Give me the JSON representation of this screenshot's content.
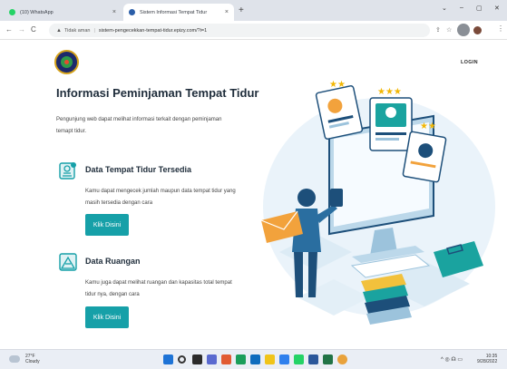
{
  "browser": {
    "tabs": [
      {
        "title": "(10) WhatsApp",
        "favicon_color": "#25d366"
      },
      {
        "title": "Sistem Informasi Tempat Tidur",
        "favicon_color": "#2b5ea8"
      }
    ],
    "new_tab_label": "+",
    "close_label": "×",
    "window_controls": [
      "⌄",
      "–",
      "▢",
      "✕"
    ],
    "nav": {
      "back": "←",
      "forward": "→",
      "reload": "C"
    },
    "address": {
      "security_label": "Tidak aman",
      "url": "sistem-pengecekkan-tempat-tidur.epizy.com/?i=1"
    }
  },
  "site": {
    "login_label": "LOGIN"
  },
  "content": {
    "heading": "Informasi Peminjaman Tempat Tidur",
    "intro": "Pengunjung web dapat melihat informasi terkait dengan peminjaman temapt tidur.",
    "features": [
      {
        "icon": "bed-info-icon",
        "title": "Data Tempat Tidur Tersedia",
        "description": "Kamu dapat mengecek jumlah maupun data tempat tidur yang masih tersedia dengan cara",
        "button_label": "Klik Disini"
      },
      {
        "icon": "room-icon",
        "title": "Data Ruangan",
        "description": "Kamu juga dapat melihat ruangan dan kapasitas total tempat tidur nya, dengan cara",
        "button_label": "Klik Disini"
      }
    ]
  },
  "taskbar": {
    "weather_temp": "27°F",
    "weather_text": "Cloudy",
    "tray_icons": "^ ◎ ☊ ▭",
    "clock_time": "10:35",
    "clock_date": "9/28/2022"
  },
  "colors": {
    "accent": "#16a0a8",
    "heading": "#1e2c3a",
    "illustration_blue": "#bcd8ea",
    "illustration_dark": "#1d4f7a"
  }
}
